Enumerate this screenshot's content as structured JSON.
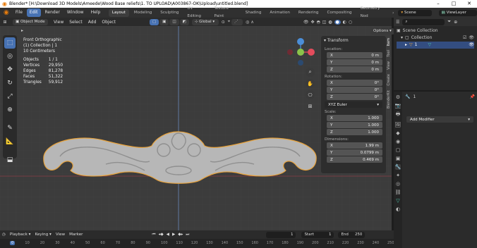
{
  "window": {
    "title": "Blender* [H:\\Download 3D Models\\Ameede\\Wood Base reliefs\\1. TO UPLOAD\\A003867-OK\\Upload\\untitled.blend]"
  },
  "menu": [
    "File",
    "Edit",
    "Render",
    "Window",
    "Help"
  ],
  "workspaces": [
    "Layout",
    "Modeling",
    "Sculpting",
    "UV Editing",
    "Texture Paint",
    "Shading",
    "Animation",
    "Rendering",
    "Compositing",
    "Geometry Nod"
  ],
  "scene": {
    "scene_label": "Scene",
    "view_layer_label": "ViewLayer"
  },
  "viewport_header": {
    "mode": "Object Mode",
    "menus": [
      "View",
      "Select",
      "Add",
      "Object"
    ],
    "transform_orientation": "Global",
    "options": "Options"
  },
  "overlay_info": {
    "view": "Front Orthographic",
    "collection": "(1) Collection | 1",
    "scale": "10 Centimeters"
  },
  "stats": [
    {
      "label": "Objects",
      "value": "1 / 1"
    },
    {
      "label": "Vertices",
      "value": "29,950"
    },
    {
      "label": "Edges",
      "value": "81,278"
    },
    {
      "label": "Faces",
      "value": "51,322"
    },
    {
      "label": "Triangles",
      "value": "59,912"
    }
  ],
  "npanel": {
    "header": "Transform",
    "location_label": "Location:",
    "location": [
      {
        "axis": "X",
        "value": "0 m"
      },
      {
        "axis": "Y",
        "value": "0 m"
      },
      {
        "axis": "Z",
        "value": "0 m"
      }
    ],
    "rotation_label": "Rotation:",
    "rotation": [
      {
        "axis": "X",
        "value": "0°"
      },
      {
        "axis": "Y",
        "value": "0°"
      },
      {
        "axis": "Z",
        "value": "0°"
      }
    ],
    "rotation_mode": "XYZ Euler",
    "scale_label": "Scale:",
    "scale": [
      {
        "axis": "X",
        "value": "1.000"
      },
      {
        "axis": "Y",
        "value": "1.000"
      },
      {
        "axis": "Z",
        "value": "1.000"
      }
    ],
    "dimensions_label": "Dimensions:",
    "dimensions": [
      {
        "axis": "X",
        "value": "1.99 m"
      },
      {
        "axis": "Y",
        "value": "0.0799 m"
      },
      {
        "axis": "Z",
        "value": "0.469 m"
      }
    ],
    "tabs": [
      "Item",
      "Tool",
      "View",
      "Create",
      "BlenderKit"
    ]
  },
  "outliner": {
    "scene_collection": "Scene Collection",
    "collection": "Collection",
    "object": "1"
  },
  "properties": {
    "object_name": "1",
    "add_modifier": "Add Modifier"
  },
  "timeline": {
    "menus": [
      "Playback",
      "Keying",
      "View",
      "Marker"
    ],
    "current_frame": "1",
    "start_label": "Start",
    "start": "1",
    "end_label": "End",
    "end": "250",
    "ruler": [
      "0",
      "10",
      "20",
      "30",
      "40",
      "50",
      "60",
      "70",
      "80",
      "90",
      "100",
      "110",
      "120",
      "130",
      "140",
      "150",
      "160",
      "170",
      "180",
      "190",
      "200",
      "210",
      "220",
      "230",
      "240",
      "250"
    ]
  },
  "colors": {
    "accent": "#4772b3",
    "selection_outline": "#e8a33c",
    "axis_x": "#e44c5c",
    "axis_y": "#8bc34a",
    "axis_z": "#4b8ed8"
  }
}
